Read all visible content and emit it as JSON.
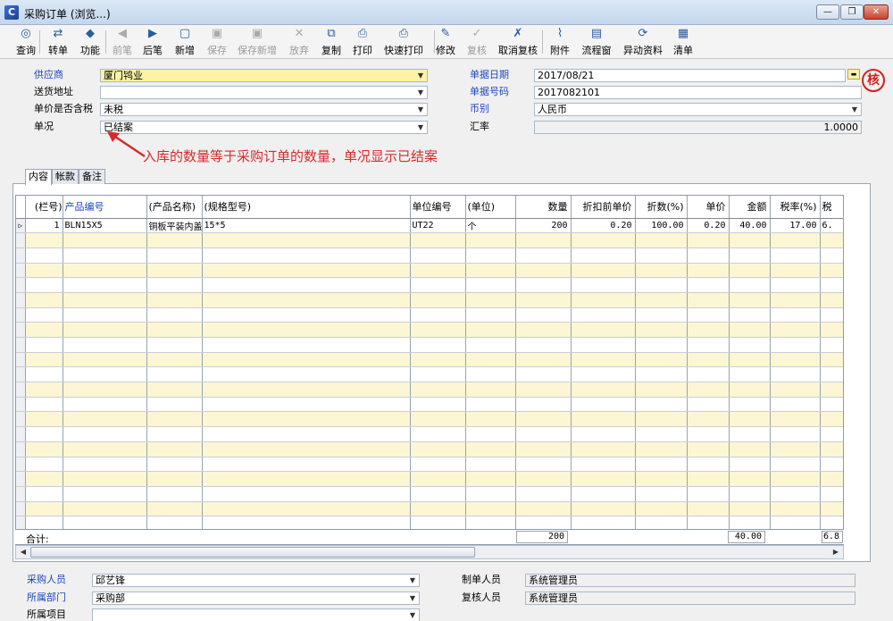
{
  "window": {
    "title": "采购订单 (浏览...)"
  },
  "toolbar": [
    {
      "label": "查询",
      "icon": "◎",
      "enabled": true
    },
    {
      "label": "转单",
      "icon": "⇄",
      "enabled": true
    },
    {
      "label": "功能",
      "icon": "◆",
      "enabled": true
    },
    {
      "label": "前笔",
      "icon": "◀",
      "enabled": false
    },
    {
      "label": "后笔",
      "icon": "▶",
      "enabled": true
    },
    {
      "label": "新增",
      "icon": "▢",
      "enabled": true
    },
    {
      "label": "保存",
      "icon": "▣",
      "enabled": false
    },
    {
      "label": "保存新增",
      "icon": "▣",
      "enabled": false
    },
    {
      "label": "放弃",
      "icon": "✕",
      "enabled": false
    },
    {
      "label": "复制",
      "icon": "⧉",
      "enabled": true
    },
    {
      "label": "打印",
      "icon": "⎙",
      "enabled": true
    },
    {
      "label": "快速打印",
      "icon": "⎙",
      "enabled": true
    },
    {
      "label": "修改",
      "icon": "✎",
      "enabled": true
    },
    {
      "label": "复核",
      "icon": "✓",
      "enabled": false
    },
    {
      "label": "取消复核",
      "icon": "✗",
      "enabled": true
    },
    {
      "label": "附件",
      "icon": "⌇",
      "enabled": true
    },
    {
      "label": "流程窗",
      "icon": "▤",
      "enabled": true
    },
    {
      "label": "异动资料",
      "icon": "⟳",
      "enabled": true
    },
    {
      "label": "清单",
      "icon": "▦",
      "enabled": true
    }
  ],
  "header": {
    "supplier_label": "供应商",
    "supplier_value": "厦门鸨业",
    "address_label": "送货地址",
    "address_value": "",
    "tax_label": "单价是否含税",
    "tax_value": "未税",
    "status_label": "单况",
    "status_value": "已结案",
    "date_label": "单据日期",
    "date_value": "2017/08/21",
    "number_label": "单据号码",
    "number_value": "2017082101",
    "currency_label": "币别",
    "currency_value": "人民币",
    "rate_label": "汇率",
    "rate_value": "1.0000",
    "stamp_text": "核"
  },
  "annotation": "入库的数量等于采购订单的数量，单况显示已结案",
  "tabs": [
    "内容",
    "帐款",
    "备注"
  ],
  "grid": {
    "columns": [
      "(栏号)",
      "产品编号",
      "(产品名称)",
      "(规格型号)",
      "单位编号",
      "(单位)",
      "数量",
      "折扣前单价",
      "折数(%)",
      "单价",
      "金额",
      "税率(%)",
      "税"
    ],
    "rows": [
      [
        "1",
        "BLN15X5",
        "铜板平装内盖",
        "15*5",
        "UT22",
        "个",
        "200",
        "0.20",
        "100.00",
        "0.20",
        "40.00",
        "17.00",
        "6."
      ]
    ],
    "empty_rows": 20,
    "total_label": "合计:",
    "total_qty": "200",
    "total_amount": "40.00",
    "total_tax": "6.8"
  },
  "footer": {
    "buyer_label": "采购人员",
    "buyer_value": "邱艺锋",
    "dept_label": "所属部门",
    "dept_value": "采购部",
    "project_label": "所属项目",
    "project_value": "",
    "maker_label": "制单人员",
    "maker_value": "系统管理员",
    "reviewer_label": "复核人员",
    "reviewer_value": "系统管理员"
  }
}
